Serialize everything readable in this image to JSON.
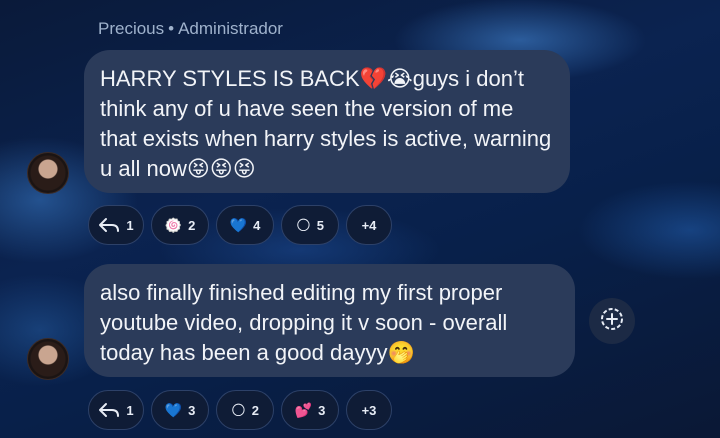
{
  "header": {
    "sender": "Precious",
    "separator": "•",
    "role": "Administrador"
  },
  "messages": [
    {
      "text": "HARRY STYLES IS BACK💔😭guys i don’t think any of u have seen the version of me that exists when harry styles is active, warning u all now😝😝😝",
      "reply_count": "1",
      "reactions": [
        {
          "emoji": "🍥",
          "count": "2"
        },
        {
          "emoji": "💙",
          "count": "4"
        },
        {
          "emoji": "🌕",
          "count": "5"
        }
      ],
      "more": "+4"
    },
    {
      "text": "also finally finished editing my first proper youtube video, dropping it v soon - overall today has been a good dayyy🤭",
      "reply_count": "1",
      "reactions": [
        {
          "emoji": "💙",
          "count": "3"
        },
        {
          "emoji": "🌕",
          "count": "2"
        },
        {
          "emoji": "💕",
          "count": "3"
        }
      ],
      "more": "+3"
    }
  ],
  "icons": {
    "reply": "reply-arrow-icon",
    "add_reaction": "add-reaction-icon",
    "avatar": "user-avatar"
  }
}
